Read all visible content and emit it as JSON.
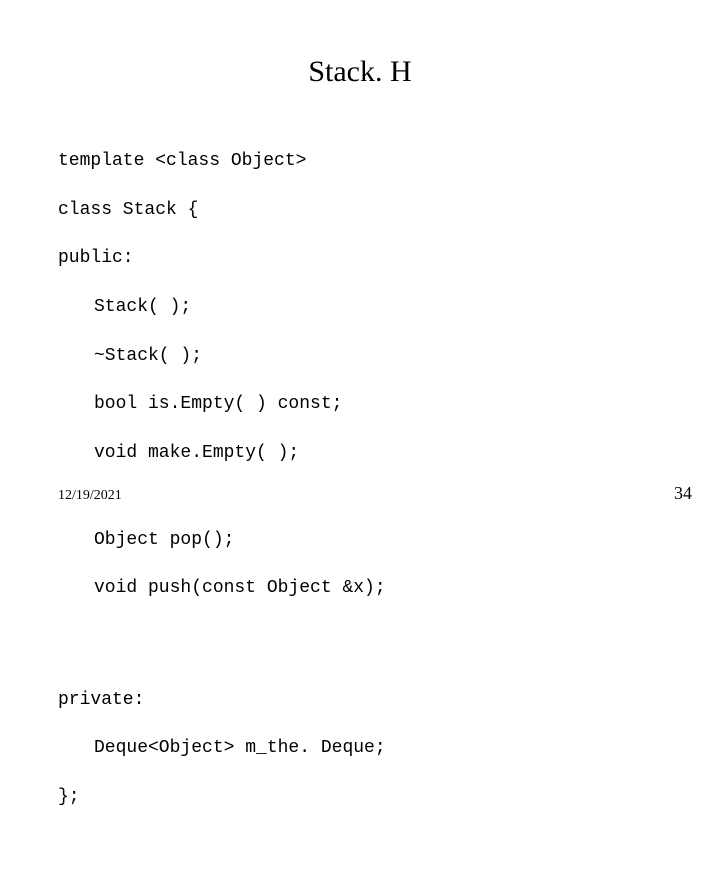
{
  "title": "Stack. H",
  "code": {
    "l1": "template <class Object>",
    "l2": "class Stack {",
    "l3": "public:",
    "l4": "Stack( );",
    "l5": "~Stack( );",
    "l6": "bool is.Empty( ) const;",
    "l7": "void make.Empty( );",
    "l8": "Object pop();",
    "l9": "void push(const Object &x);",
    "l10": "private:",
    "l11": "Deque<Object> m_the. Deque;",
    "l12": "};"
  },
  "footer": {
    "date": "12/19/2021",
    "page": "34"
  }
}
